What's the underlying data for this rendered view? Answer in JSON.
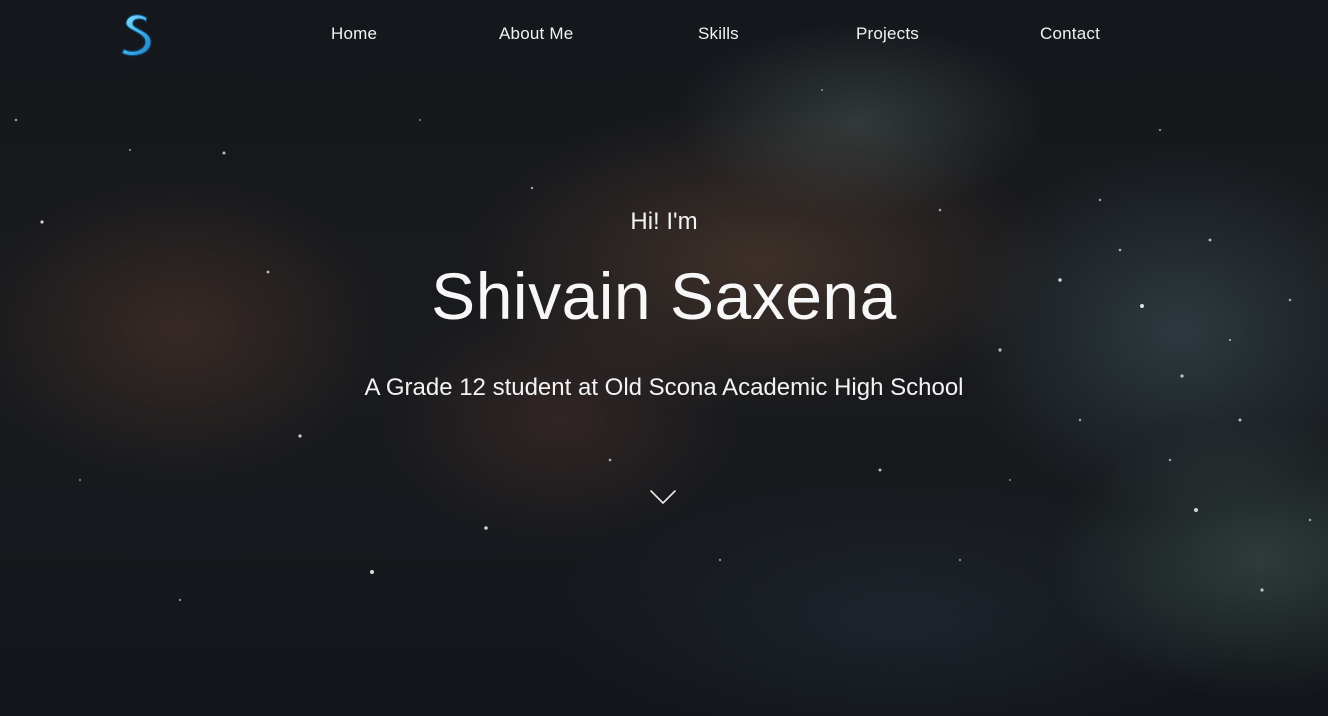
{
  "nav": {
    "logo_letter": "S",
    "links": [
      "Home",
      "About Me",
      "Skills",
      "Projects",
      "Contact"
    ]
  },
  "hero": {
    "greeting": "Hi! I'm",
    "name": "Shivain Saxena",
    "tagline": "A Grade 12 student at Old Scona Academic High School"
  },
  "icons": {
    "logo": "s-logo-icon",
    "scroll": "chevron-down-icon"
  },
  "colors": {
    "logo_blue": "#4fc3f7",
    "text": "#ffffff",
    "background": "#16191d"
  }
}
